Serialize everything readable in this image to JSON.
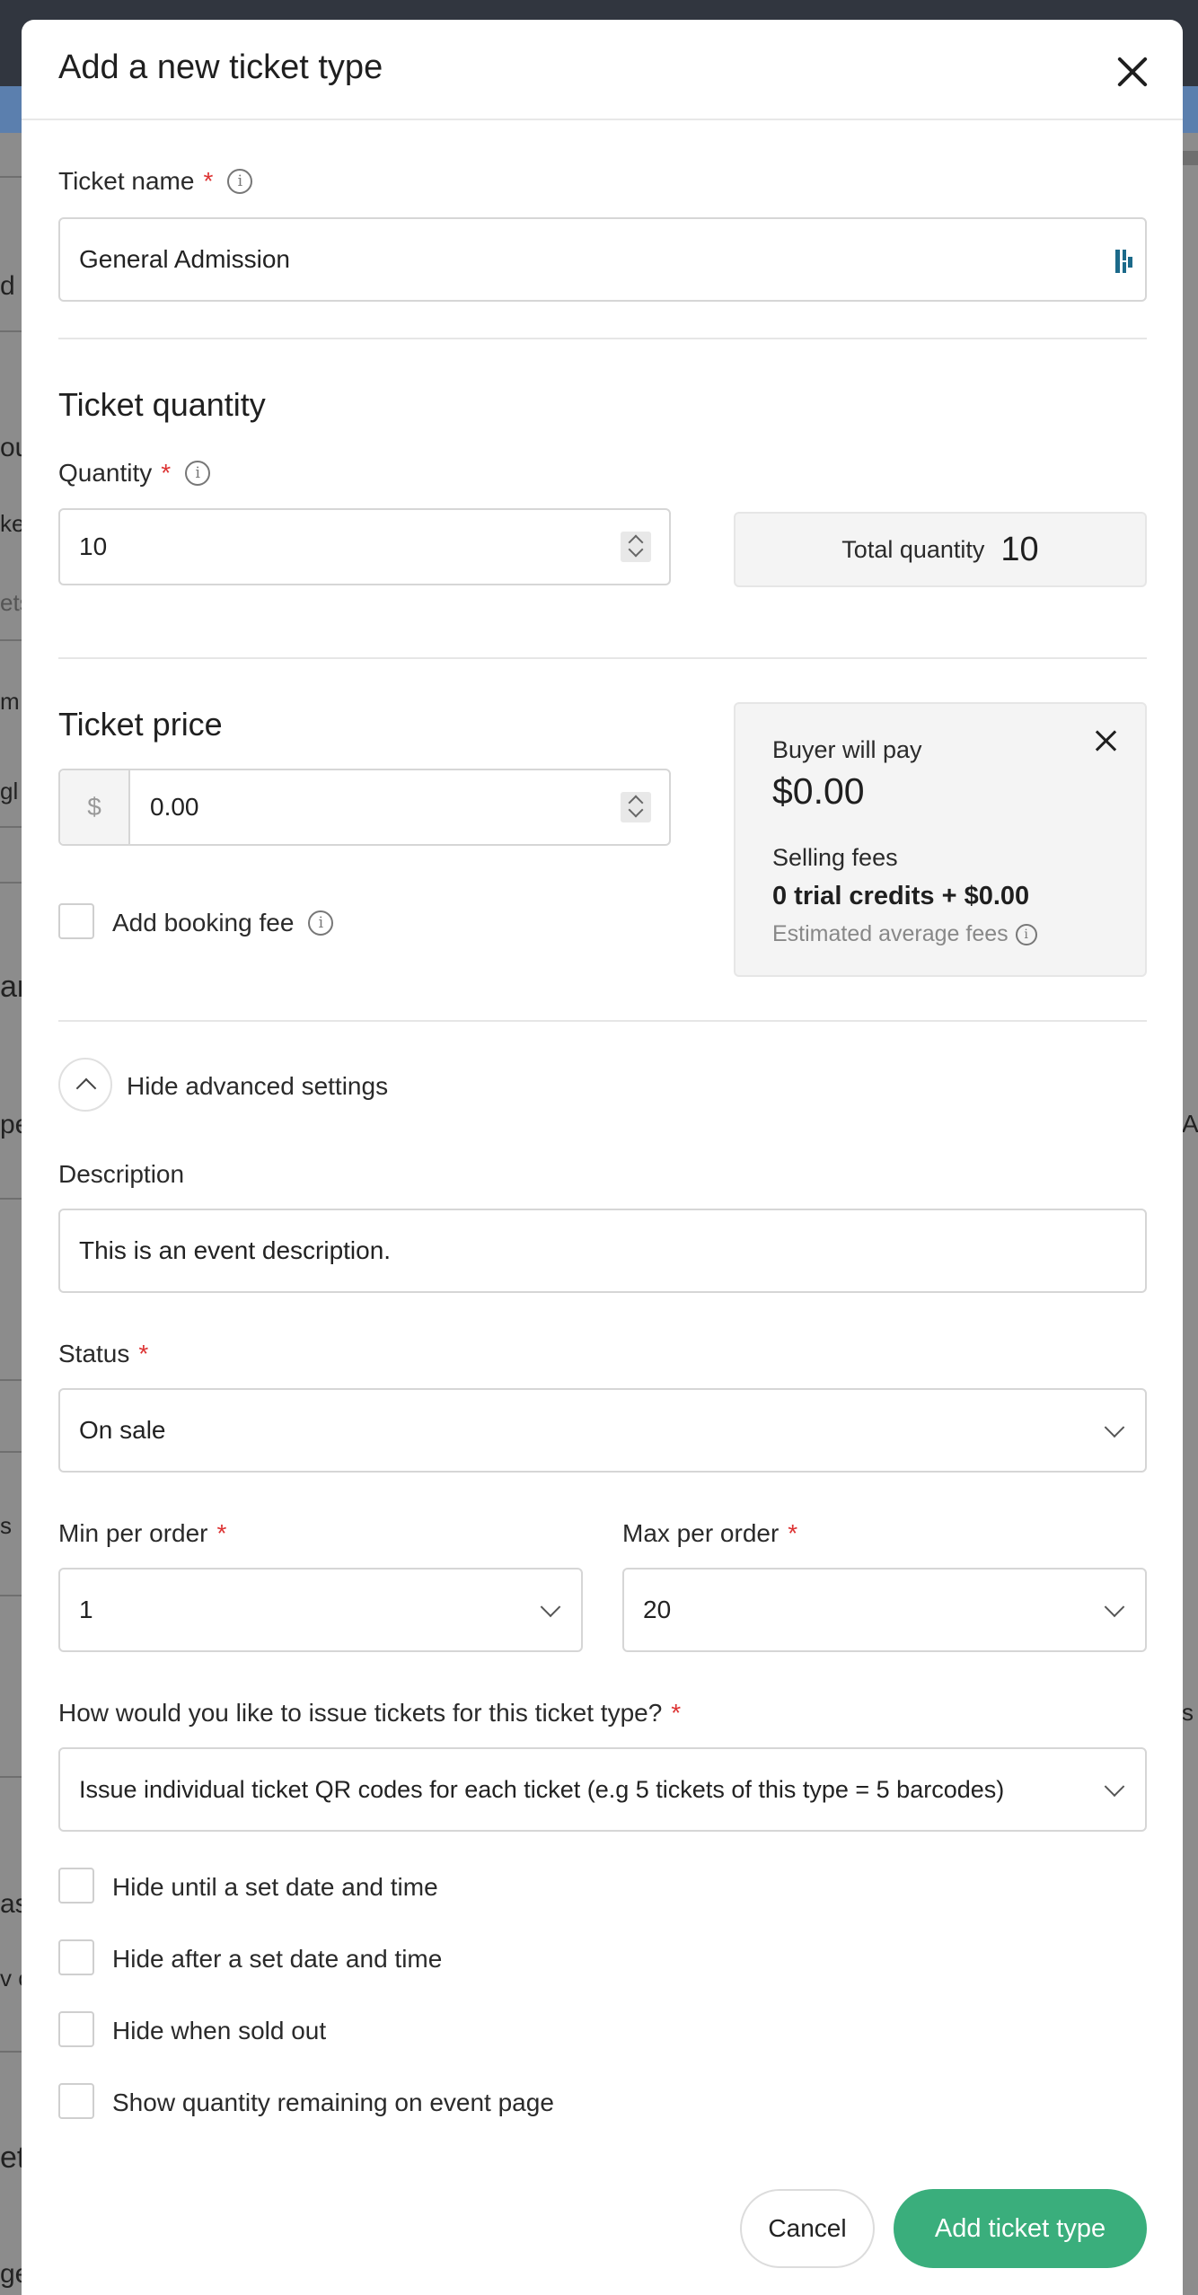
{
  "backdrop": {
    "left_fragments": [
      "d",
      "ou",
      "ket",
      "ets",
      "m",
      "gl",
      "ar",
      "pe",
      "s",
      "as",
      "v c",
      "et",
      "ge"
    ],
    "right_fragments": [
      "Ac",
      "s a"
    ]
  },
  "modal": {
    "title": "Add a new ticket type"
  },
  "ticket_name": {
    "label": "Ticket name",
    "required_mark": "*",
    "value": "General Admission"
  },
  "quantity_section": {
    "title": "Ticket quantity",
    "label": "Quantity",
    "required_mark": "*",
    "value": "10",
    "total_label": "Total quantity",
    "total_value": "10"
  },
  "price_section": {
    "title": "Ticket price",
    "currency_symbol": "$",
    "value": "0.00",
    "booking_fee_label": "Add booking fee"
  },
  "summary": {
    "buyer_label": "Buyer will pay",
    "buyer_amount": "$0.00",
    "fees_label": "Selling fees",
    "fees_value": "0 trial credits + $0.00",
    "fees_note": "Estimated average fees"
  },
  "advanced": {
    "toggle_label": "Hide advanced settings"
  },
  "description": {
    "label": "Description",
    "value": "This is an event description."
  },
  "status": {
    "label": "Status",
    "required_mark": "*",
    "value": "On sale"
  },
  "min_per_order": {
    "label": "Min per order",
    "required_mark": "*",
    "value": "1"
  },
  "max_per_order": {
    "label": "Max per order",
    "required_mark": "*",
    "value": "20"
  },
  "issue": {
    "label": "How would you like to issue tickets for this ticket type?",
    "required_mark": "*",
    "value": "Issue individual ticket QR codes for each ticket (e.g 5 tickets of this type = 5 barcodes)"
  },
  "options": [
    "Hide until a set date and time",
    "Hide after a set date and time",
    "Hide when sold out",
    "Show quantity remaining on event page"
  ],
  "footer": {
    "cancel_label": "Cancel",
    "submit_label": "Add ticket type"
  },
  "colors": {
    "accent": "#3aae7c",
    "required": "#dd3333",
    "topbar": "#31363f",
    "bluebar": "#5b7fae"
  }
}
